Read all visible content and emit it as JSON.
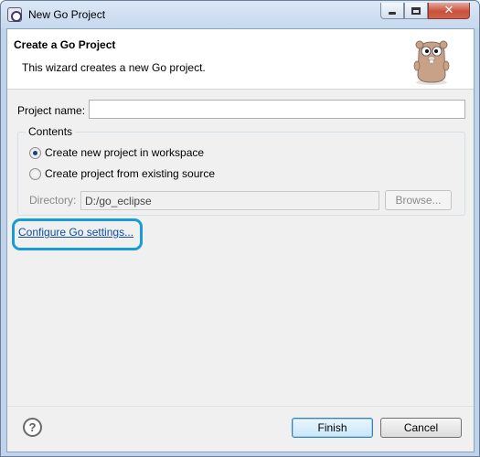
{
  "window": {
    "title": "New Go Project"
  },
  "header": {
    "title": "Create a Go Project",
    "description": "This wizard creates a new Go project."
  },
  "project": {
    "label": "Project name:",
    "value": ""
  },
  "contents": {
    "legend": "Contents",
    "options": [
      {
        "label": "Create new project in workspace",
        "checked": true
      },
      {
        "label": "Create project from existing source",
        "checked": false
      }
    ],
    "directory_label": "Directory:",
    "directory_value": "D:/go_eclipse",
    "browse_label": "Browse..."
  },
  "configure_link": "Configure Go settings...",
  "buttons": {
    "finish": "Finish",
    "cancel": "Cancel",
    "help": "?"
  },
  "colors": {
    "link": "#0f4ea3",
    "highlight": "#1a9ad6"
  },
  "icons": [
    "app-icon",
    "minimize-icon",
    "maximize-icon",
    "close-icon",
    "gopher-icon",
    "help-icon"
  ]
}
